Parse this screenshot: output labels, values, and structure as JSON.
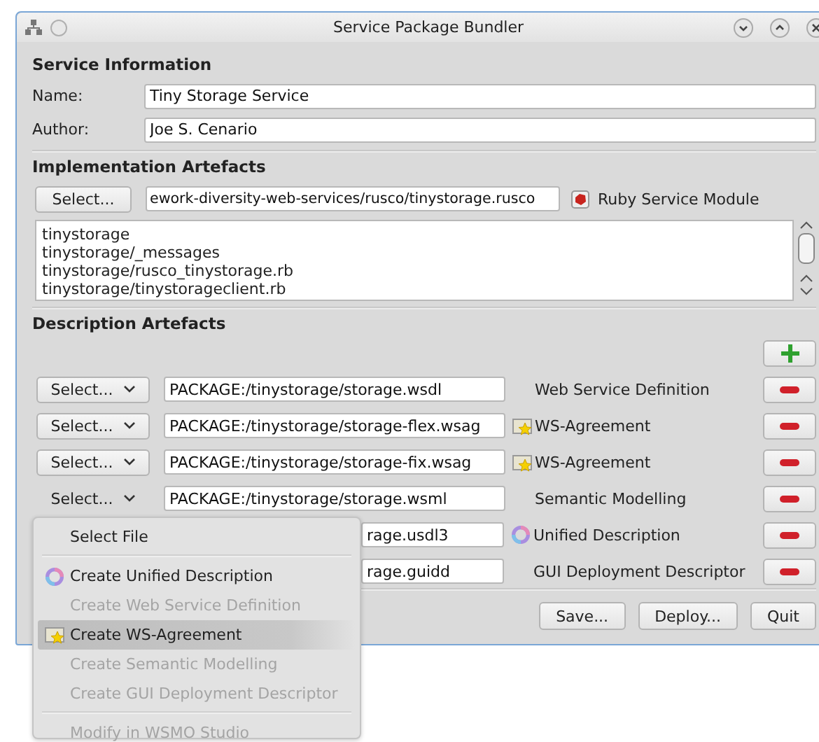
{
  "window": {
    "title": "Service Package Bundler"
  },
  "service_information": {
    "heading": "Service Information",
    "fields": [
      {
        "label": "Name:",
        "value": "Tiny Storage Service"
      },
      {
        "label": "Author:",
        "value": "Joe S. Cenario"
      }
    ]
  },
  "implementation_artefacts": {
    "heading": "Implementation Artefacts",
    "select_button": "Select...",
    "path": "ework-diversity-web-services/rusco/tinystorage.rusco",
    "type_label": "Ruby Service Module",
    "files": [
      "tinystorage",
      "tinystorage/_messages",
      "tinystorage/rusco_tinystorage.rb",
      "tinystorage/tinystorageclient.rb"
    ]
  },
  "description_artefacts": {
    "heading": "Description Artefacts",
    "rows": [
      {
        "kind": "plain",
        "covered": false,
        "select_button": "Select...",
        "open": false,
        "path": "PACKAGE:/tinystorage/storage.wsdl",
        "type_label": "Web Service Definition"
      },
      {
        "kind": "agreement",
        "covered": false,
        "select_button": "Select...",
        "open": false,
        "path": "PACKAGE:/tinystorage/storage-flex.wsag",
        "type_label": "WS-Agreement"
      },
      {
        "kind": "agreement",
        "covered": false,
        "select_button": "Select...",
        "open": false,
        "path": "PACKAGE:/tinystorage/storage-fix.wsag",
        "type_label": "WS-Agreement"
      },
      {
        "kind": "plain",
        "covered": false,
        "select_button": "Select...",
        "open": true,
        "path": "PACKAGE:/tinystorage/storage.wsml",
        "type_label": "Semantic Modelling"
      },
      {
        "kind": "unified",
        "covered": true,
        "path": "rage.usdl3",
        "type_label": "Unified Description"
      },
      {
        "kind": "plain",
        "covered": true,
        "path": "rage.guidd",
        "type_label": "GUI Deployment Descriptor"
      }
    ]
  },
  "buttons": [
    "Save...",
    "Deploy...",
    "Quit"
  ],
  "menu": {
    "items": [
      {
        "kind": "plain",
        "label": "Select File",
        "disabled": false,
        "selected": false
      },
      {
        "kind": "separator"
      },
      {
        "kind": "unified",
        "label": "Create Unified Description",
        "disabled": false,
        "selected": false
      },
      {
        "kind": "plain",
        "label": "Create Web Service Definition",
        "disabled": true,
        "selected": false
      },
      {
        "kind": "agreement",
        "label": "Create WS-Agreement",
        "disabled": false,
        "selected": true
      },
      {
        "kind": "plain",
        "label": "Create Semantic Modelling",
        "disabled": true,
        "selected": false
      },
      {
        "kind": "plain",
        "label": "Create GUI Deployment Descriptor",
        "disabled": true,
        "selected": false
      },
      {
        "kind": "separator"
      },
      {
        "kind": "plain",
        "label": "Modify in WSMO Studio",
        "disabled": true,
        "selected": false
      }
    ]
  }
}
